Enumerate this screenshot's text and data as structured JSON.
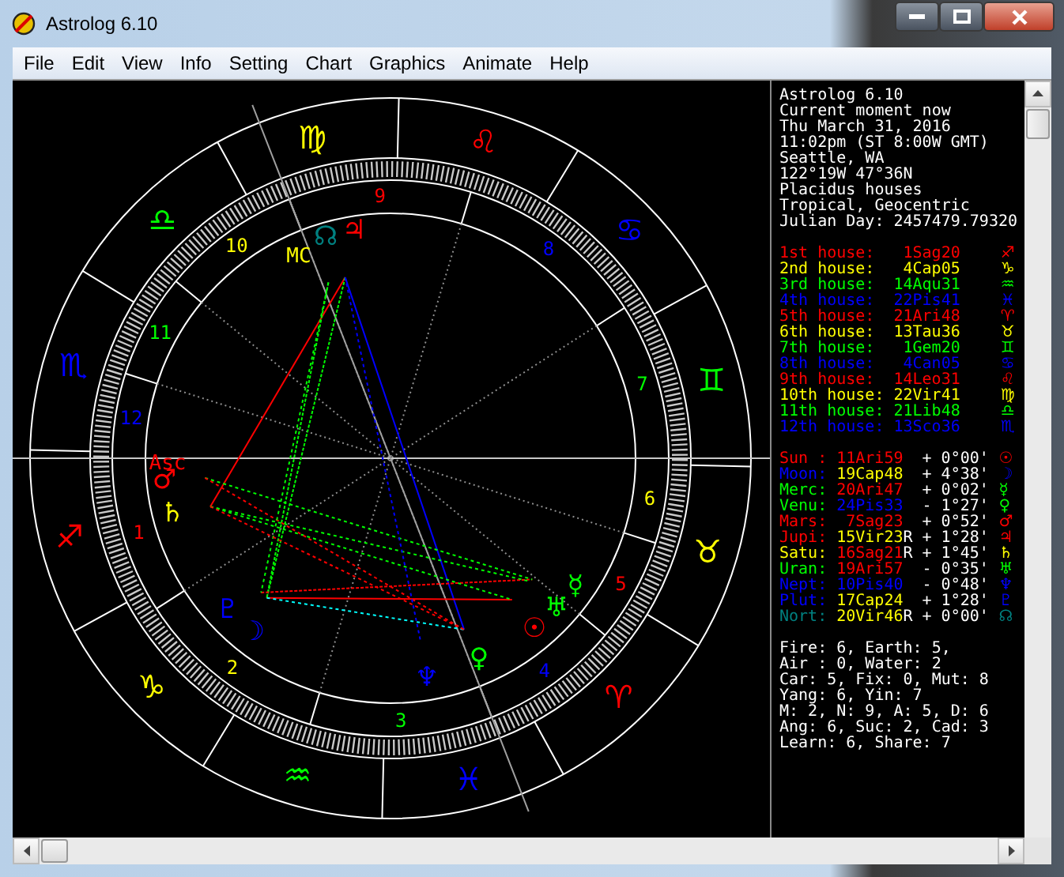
{
  "window": {
    "title": "Astrolog 6.10"
  },
  "menu": [
    "File",
    "Edit",
    "View",
    "Info",
    "Setting",
    "Chart",
    "Graphics",
    "Animate",
    "Help"
  ],
  "wheel": {
    "signs": [
      {
        "glyph": "♈",
        "color": "#ff0000"
      },
      {
        "glyph": "♉",
        "color": "#ffff00"
      },
      {
        "glyph": "♊",
        "color": "#00ff00"
      },
      {
        "glyph": "♋",
        "color": "#0000ff"
      },
      {
        "glyph": "♌",
        "color": "#ff0000"
      },
      {
        "glyph": "♍",
        "color": "#ffff00"
      },
      {
        "glyph": "♎",
        "color": "#00ff00"
      },
      {
        "glyph": "♏",
        "color": "#0000ff"
      },
      {
        "glyph": "♐",
        "color": "#ff0000"
      },
      {
        "glyph": "♑",
        "color": "#ffff00"
      },
      {
        "glyph": "♒",
        "color": "#00ff00"
      },
      {
        "glyph": "♓",
        "color": "#0000ff"
      }
    ],
    "houses": [
      {
        "label": "1",
        "color": "#ff0000"
      },
      {
        "label": "2",
        "color": "#ffff00"
      },
      {
        "label": "3",
        "color": "#00ff00"
      },
      {
        "label": "4",
        "color": "#0000ff"
      },
      {
        "label": "5",
        "color": "#ff0000"
      },
      {
        "label": "6",
        "color": "#ffff00"
      },
      {
        "label": "7",
        "color": "#00ff00"
      },
      {
        "label": "8",
        "color": "#0000ff"
      },
      {
        "label": "9",
        "color": "#ff0000"
      },
      {
        "label": "10",
        "color": "#ffff00"
      },
      {
        "label": "11",
        "color": "#00ff00"
      },
      {
        "label": "12",
        "color": "#0000ff"
      }
    ],
    "planets": [
      {
        "glyph": "☉",
        "color": "#ff0000"
      },
      {
        "glyph": "☽",
        "color": "#0000ff"
      },
      {
        "glyph": "☿",
        "color": "#00ff00"
      },
      {
        "glyph": "♀",
        "color": "#00ff00"
      },
      {
        "glyph": "♂",
        "color": "#ff0000"
      },
      {
        "glyph": "♃",
        "color": "#ff0000"
      },
      {
        "glyph": "♄",
        "color": "#ffff00"
      },
      {
        "glyph": "♅",
        "color": "#00ff00"
      },
      {
        "glyph": "♆",
        "color": "#0000ff"
      },
      {
        "glyph": "♇",
        "color": "#0000ff"
      },
      {
        "glyph": "☊",
        "color": "#008080"
      }
    ],
    "angles": [
      {
        "label": "Asc",
        "color": "#ff0000"
      },
      {
        "label": "MC",
        "color": "#ffff00"
      }
    ]
  },
  "info": {
    "header": [
      "Astrolog 6.10",
      "Current moment now",
      "Thu March 31, 2016",
      "11:02pm (ST 8:00W GMT)",
      "Seattle, WA",
      "122°19W 47°36N",
      "Placidus houses",
      "Tropical, Geocentric",
      "Julian Day: 2457479.79320"
    ],
    "houses": [
      {
        "label": "1st house:",
        "value": "1Sag20",
        "glyph": "♐",
        "color": "#ff0000"
      },
      {
        "label": "2nd house:",
        "value": "4Cap05",
        "glyph": "♑",
        "color": "#ffff00"
      },
      {
        "label": "3rd house:",
        "value": "14Aqu31",
        "glyph": "♒",
        "color": "#00ff00"
      },
      {
        "label": "4th house:",
        "value": "22Pis41",
        "glyph": "♓",
        "color": "#0000ff"
      },
      {
        "label": "5th house:",
        "value": "21Ari48",
        "glyph": "♈",
        "color": "#ff0000"
      },
      {
        "label": "6th house:",
        "value": "13Tau36",
        "glyph": "♉",
        "color": "#ffff00"
      },
      {
        "label": "7th house:",
        "value": "1Gem20",
        "glyph": "♊",
        "color": "#00ff00"
      },
      {
        "label": "8th house:",
        "value": "4Can05",
        "glyph": "♋",
        "color": "#0000ff"
      },
      {
        "label": "9th house:",
        "value": "14Leo31",
        "glyph": "♌",
        "color": "#ff0000"
      },
      {
        "label": "10th house:",
        "value": "22Vir41",
        "glyph": "♍",
        "color": "#ffff00"
      },
      {
        "label": "11th house:",
        "value": "21Lib48",
        "glyph": "♎",
        "color": "#00ff00"
      },
      {
        "label": "12th house:",
        "value": "13Sco36",
        "glyph": "♏",
        "color": "#0000ff"
      }
    ],
    "planets": [
      {
        "name": {
          "text": "Sun :",
          "color": "#ff0000"
        },
        "position": {
          "text": "11Ari59",
          "color": "#ff0000"
        },
        "aspect": "+ 0°00'",
        "glyph": "☉"
      },
      {
        "name": {
          "text": "Moon:",
          "color": "#0000ff"
        },
        "position": {
          "text": "19Cap48",
          "color": "#ffff00"
        },
        "aspect": "+ 4°38'",
        "glyph": "☽"
      },
      {
        "name": {
          "text": "Merc:",
          "color": "#00ff00"
        },
        "position": {
          "text": "20Ari47",
          "color": "#ff0000"
        },
        "aspect": "+ 0°02'",
        "glyph": "☿"
      },
      {
        "name": {
          "text": "Venu:",
          "color": "#00ff00"
        },
        "position": {
          "text": "24Pis33",
          "color": "#0000ff"
        },
        "aspect": "- 1°27'",
        "glyph": "♀"
      },
      {
        "name": {
          "text": "Mars:",
          "color": "#ff0000"
        },
        "position": {
          "text": "7Sag23",
          "color": "#ff0000"
        },
        "aspect": "+ 0°52'",
        "glyph": "♂"
      },
      {
        "name": {
          "text": "Jupi:",
          "color": "#ff0000"
        },
        "position": {
          "text": "15Vir23",
          "color": "#ffff00"
        },
        "retro": "R",
        "aspect": "+ 1°28'",
        "glyph": "♃"
      },
      {
        "name": {
          "text": "Satu:",
          "color": "#ffff00"
        },
        "position": {
          "text": "16Sag21",
          "color": "#ff0000"
        },
        "retro": "R",
        "aspect": "+ 1°45'",
        "glyph": "♄"
      },
      {
        "name": {
          "text": "Uran:",
          "color": "#00ff00"
        },
        "position": {
          "text": "19Ari57",
          "color": "#ff0000"
        },
        "aspect": "- 0°35'",
        "glyph": "♅"
      },
      {
        "name": {
          "text": "Nept:",
          "color": "#0000ff"
        },
        "position": {
          "text": "10Pis40",
          "color": "#0000ff"
        },
        "aspect": "- 0°48'",
        "glyph": "♆"
      },
      {
        "name": {
          "text": "Plut:",
          "color": "#0000ff"
        },
        "position": {
          "text": "17Cap24",
          "color": "#ffff00"
        },
        "aspect": "+ 1°28'",
        "glyph": "♇"
      },
      {
        "name": {
          "text": "Nort:",
          "color": "#008080"
        },
        "position": {
          "text": "20Vir46",
          "color": "#ffff00"
        },
        "retro": "R",
        "aspect": "+ 0°00'",
        "glyph": "☊"
      }
    ],
    "stats": [
      "Fire: 6, Earth: 5,",
      "Air : 0, Water: 2",
      "Car: 5, Fix: 0, Mut: 8",
      "Yang: 6, Yin: 7",
      "M: 2, N: 9, A: 5, D: 6",
      "Ang: 6, Suc: 2, Cad: 3",
      "Learn: 6, Share: 7"
    ]
  }
}
